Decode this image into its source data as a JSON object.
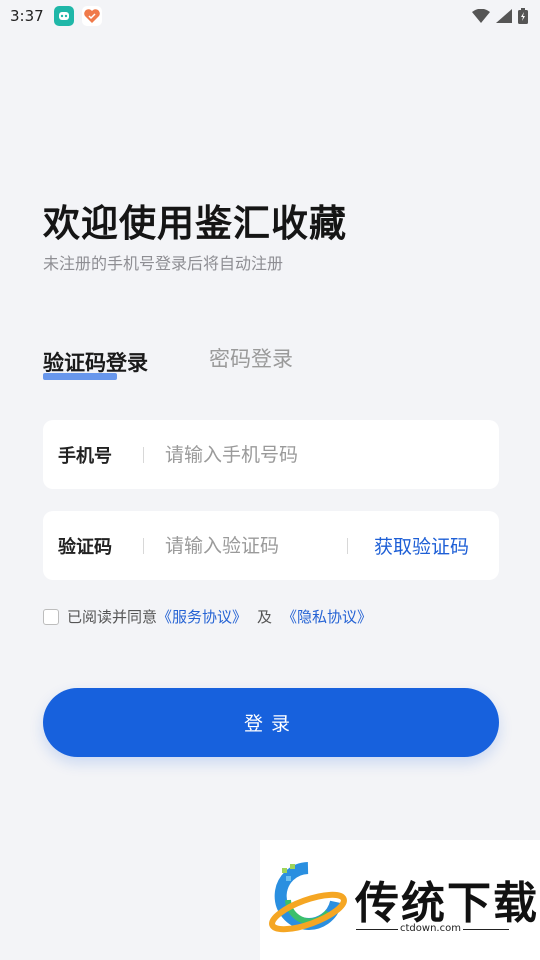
{
  "status_bar": {
    "time": "3:37",
    "icons": [
      "app-teal-icon",
      "app-heart-icon",
      "wifi-icon",
      "signal-icon",
      "battery-charging-icon"
    ]
  },
  "header": {
    "title": "欢迎使用鉴汇收藏",
    "subtitle": "未注册的手机号登录后将自动注册"
  },
  "tabs": [
    {
      "label": "验证码登录",
      "active": true
    },
    {
      "label": "密码登录",
      "active": false
    }
  ],
  "form": {
    "phone": {
      "label": "手机号",
      "placeholder": "请输入手机号码",
      "value": ""
    },
    "code": {
      "label": "验证码",
      "placeholder": "请输入验证码",
      "value": "",
      "get_code_label": "获取验证码"
    }
  },
  "agreement": {
    "prefix": "已阅读并同意",
    "service_link": "《服务协议》",
    "and": "及",
    "privacy_link": "《隐私协议》",
    "checked": false
  },
  "login_button": {
    "label": "登录"
  },
  "watermark": {
    "brand": "传统下载",
    "url": "ctdown.com"
  },
  "colors": {
    "primary": "#1761dd",
    "link": "#2563d4",
    "background": "#f3f4f7"
  }
}
